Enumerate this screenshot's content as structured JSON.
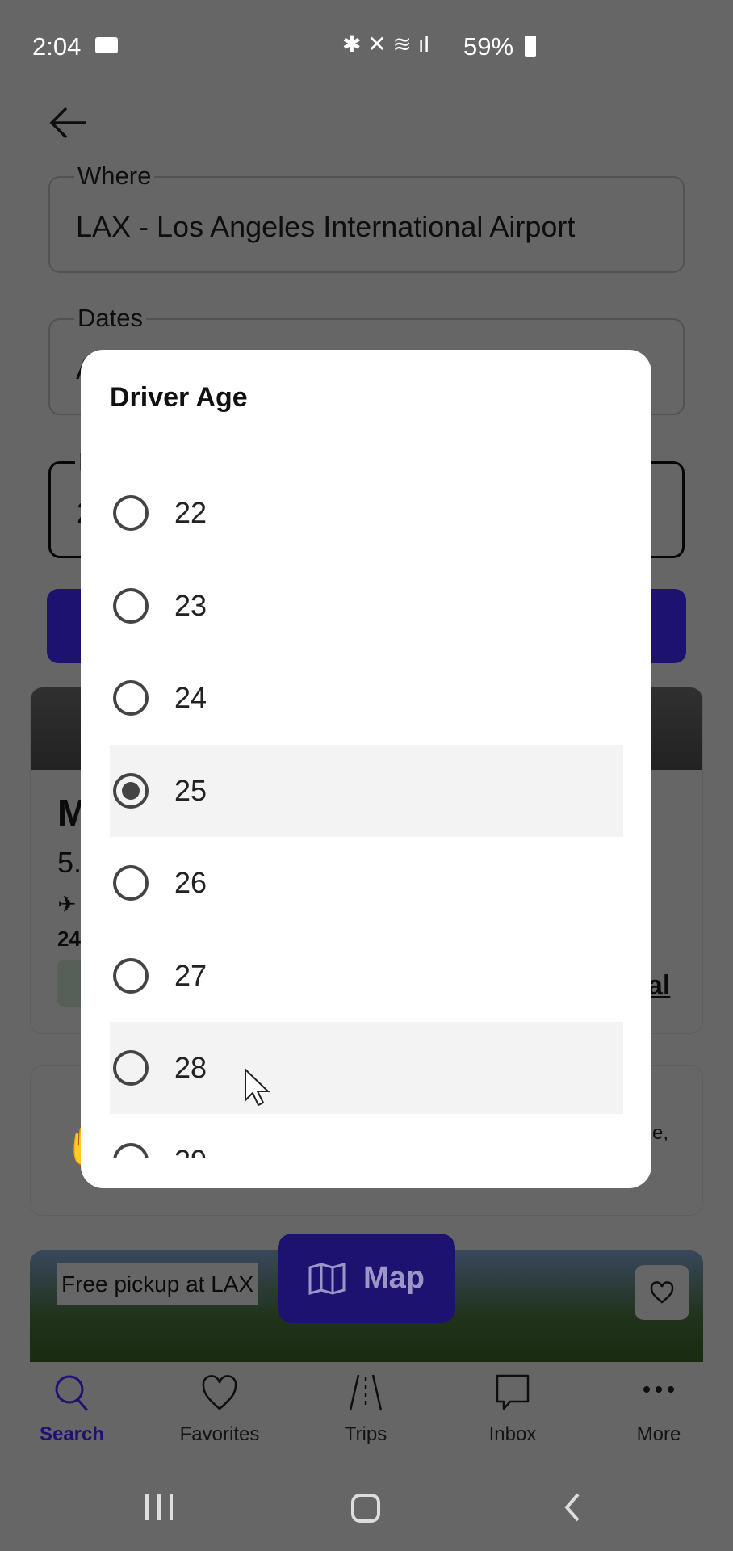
{
  "status_bar": {
    "time": "2:04",
    "battery": "59%"
  },
  "search": {
    "where_label": "Where",
    "where_value": "LAX - Los Angeles International Airport",
    "dates_label": "Dates",
    "dates_value": "A",
    "age_label": "D",
    "age_value": "2"
  },
  "card1": {
    "title": "M",
    "rating": "5.",
    "info": "24",
    "link": "al"
  },
  "card2": {
    "text": "e,"
  },
  "card3": {
    "badge": "Free pickup at LAX"
  },
  "map_button": {
    "label": "Map"
  },
  "bottom_nav": [
    {
      "label": "Search",
      "icon": "search-icon",
      "active": true
    },
    {
      "label": "Favorites",
      "icon": "heart-icon"
    },
    {
      "label": "Trips",
      "icon": "road-icon"
    },
    {
      "label": "Inbox",
      "icon": "chat-icon"
    },
    {
      "label": "More",
      "icon": "more-icon"
    }
  ],
  "colors": {
    "accent": "#4a2be0"
  },
  "dialog": {
    "title": "Driver Age",
    "selected": "25",
    "options": [
      "22",
      "23",
      "24",
      "25",
      "26",
      "27",
      "28",
      "29"
    ]
  }
}
